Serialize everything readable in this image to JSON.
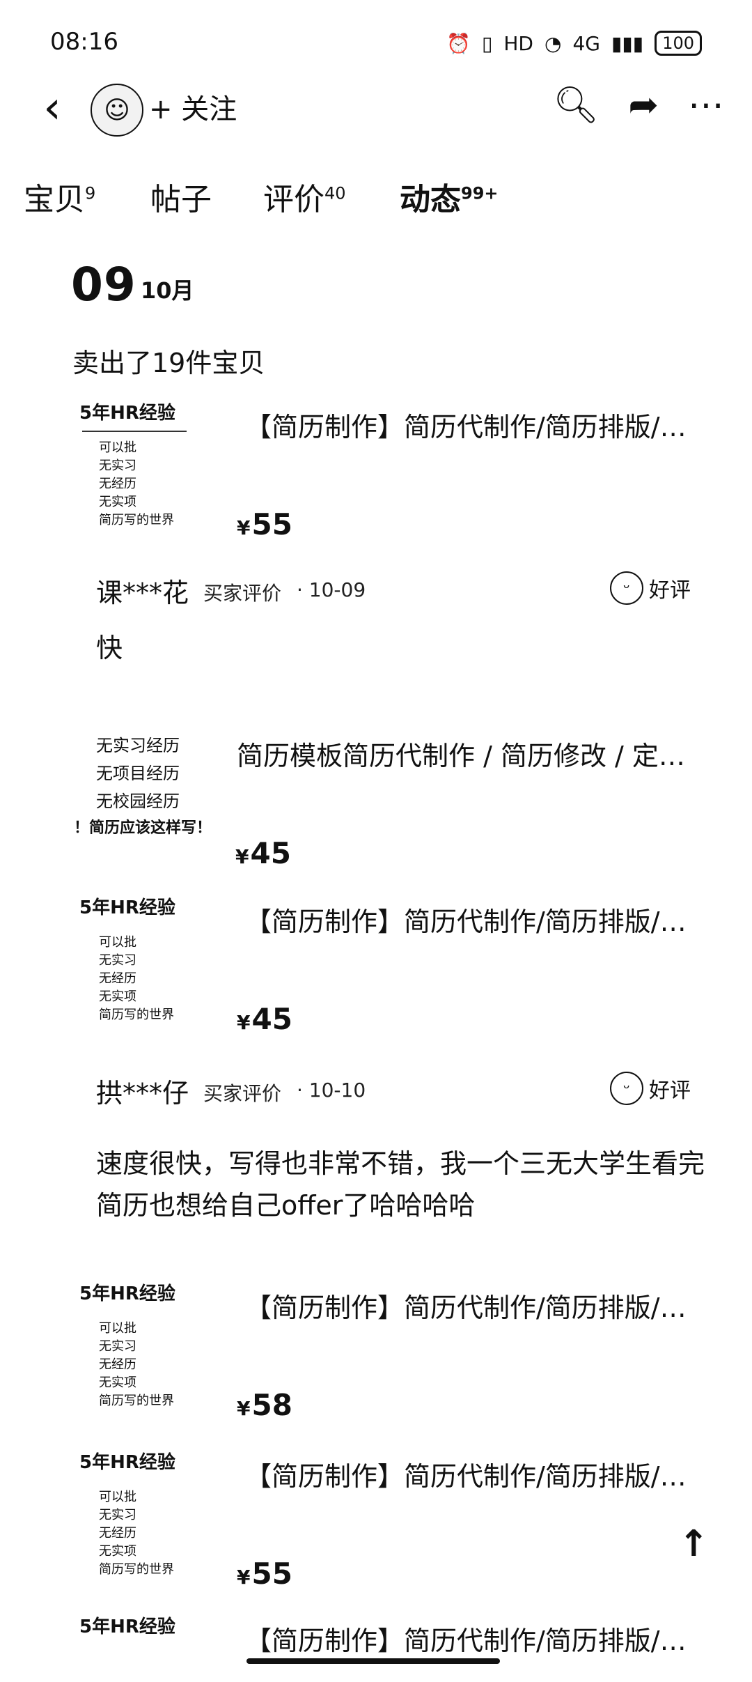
{
  "status": {
    "time": "08:16",
    "battery": "100",
    "network": "4G"
  },
  "header": {
    "follow_label": "+ 关注"
  },
  "tabs": [
    {
      "label": "宝贝",
      "count": "9"
    },
    {
      "label": "帖子",
      "count": ""
    },
    {
      "label": "评价",
      "count": "40"
    },
    {
      "label": "动态",
      "count": "99+"
    }
  ],
  "feed": {
    "date_day": "09",
    "date_month": "10月",
    "sold_text": "卖出了19件宝贝",
    "items": [
      {
        "title": "【简历制作】简历代制作/简历排版/…",
        "price": "55"
      },
      {
        "title": "简历模板简历代制作 / 简历修改 / 定…",
        "price": "45"
      },
      {
        "title": "【简历制作】简历代制作/简历排版/…",
        "price": "45"
      },
      {
        "title": "【简历制作】简历代制作/简历排版/…",
        "price": "58"
      },
      {
        "title": "【简历制作】简历代制作/简历排版/…",
        "price": "55"
      },
      {
        "title": "【简历制作】简历代制作/简历排版/…",
        "price": ""
      }
    ],
    "reviews": [
      {
        "user": "课***花",
        "label": "买家评价",
        "date": "· 10-09",
        "rating": "好评",
        "text": "快"
      },
      {
        "user": "拱***仔",
        "label": "买家评价",
        "date": "· 10-10",
        "rating": "好评",
        "text": "速度很快，写得也非常不错，我一个三无大学生看完简历也想给自己offer了哈哈哈哈"
      }
    ]
  },
  "thumbs": {
    "a_title": "5年HR经验",
    "a_lines": [
      "可以批",
      "无实习",
      "无经历",
      "无实项",
      "简历写的世界"
    ],
    "b_lines": [
      "无实习经历",
      "无项目经历",
      "无校园经历",
      "！简历应该这样写！"
    ]
  }
}
